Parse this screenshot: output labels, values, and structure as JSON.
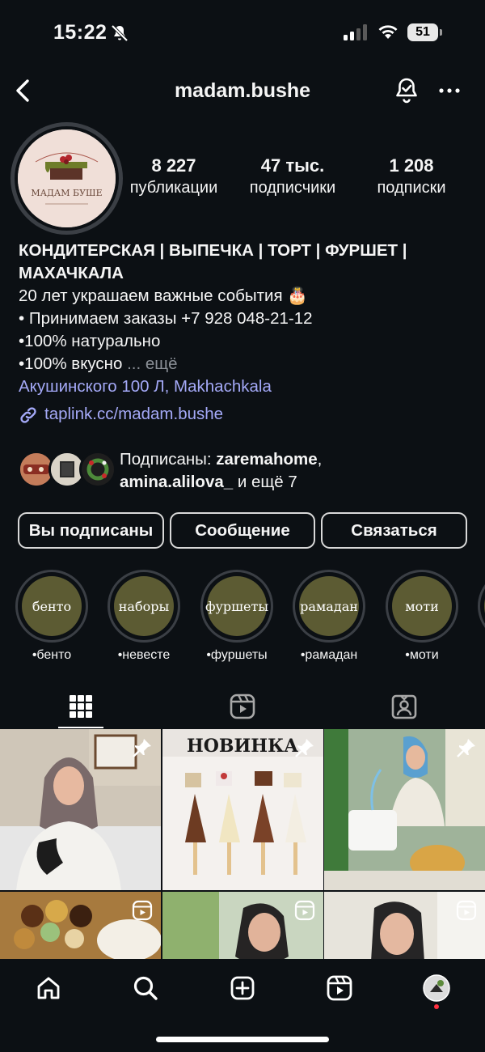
{
  "status_bar": {
    "time": "15:22",
    "battery": "51"
  },
  "header": {
    "username": "madam.bushe"
  },
  "profile": {
    "avatar_logo_text": "МАДАМ БУШЕ",
    "stats": [
      {
        "value": "8 227",
        "label": "публикации"
      },
      {
        "value": "47 тыс.",
        "label": "подписчики"
      },
      {
        "value": "1 208",
        "label": "подписки"
      }
    ],
    "bio_title": "КОНДИТЕРСКАЯ | ВЫПЕЧКА | ТОРТ | ФУРШЕТ | МАХАЧКАЛА",
    "bio_lines": [
      "20 лет украшаем важные события 🎂",
      "• Принимаем заказы +7 928 048-21-12",
      "•100% натурально",
      "•100% вкусно"
    ],
    "more_label": "... ещё",
    "location": "Акушинского 100 Л, Makhachkala",
    "link": "taplink.cc/madam.bushe"
  },
  "followed_by": {
    "prefix": "Подписаны: ",
    "name1": "zaremahome",
    "sep": ",",
    "name2": "amina.alilova_",
    "suffix": " и ещё 7"
  },
  "buttons": {
    "following": "Вы подписаны",
    "message": "Сообщение",
    "contact": "Связаться"
  },
  "highlights": [
    {
      "cover": "бенто",
      "label": "•бенто"
    },
    {
      "cover": "наборы",
      "label": "•невесте"
    },
    {
      "cover": "фуршеты",
      "label": "•фуршеты"
    },
    {
      "cover": "рамадан",
      "label": "•рамадан"
    },
    {
      "cover": "моти",
      "label": "•моти"
    }
  ],
  "grid": {
    "post2_caption": "НОВИНКА"
  },
  "colors": {
    "background": "#0c1014",
    "link": "#a4a9f7",
    "highlight_fill": "#5c5b33",
    "notification_dot": "#ff3040"
  }
}
